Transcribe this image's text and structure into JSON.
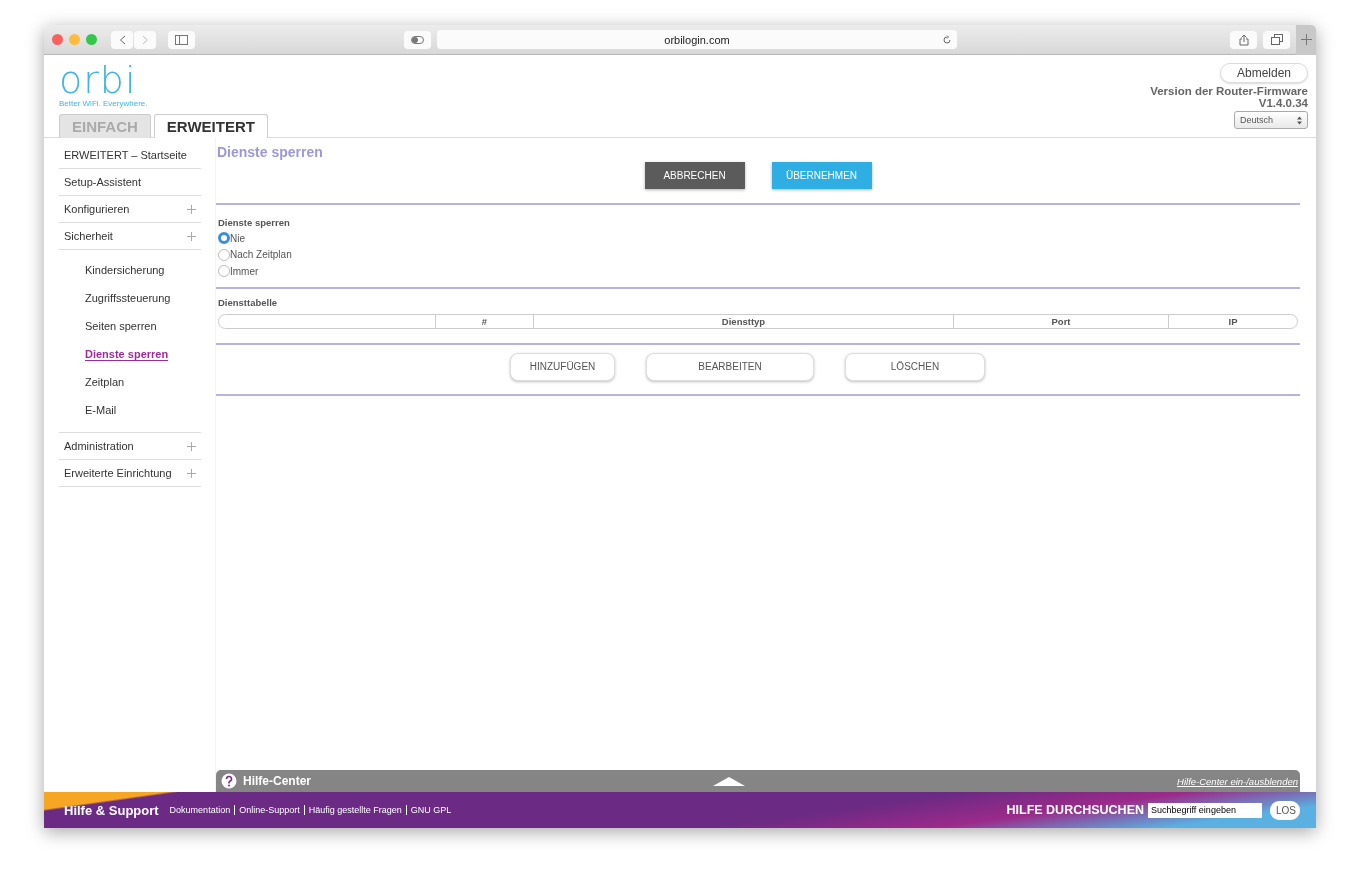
{
  "browser": {
    "url": "orbilogin.com"
  },
  "header": {
    "logo": "orbi",
    "tagline": "Better WiFi. Everywhere.",
    "logout": "Abmelden",
    "firmware_label": "Version der Router-Firmware",
    "firmware_version": "V1.4.0.34",
    "language": "Deutsch"
  },
  "mode_tabs": [
    {
      "label": "EINFACH",
      "selected": false
    },
    {
      "label": "ERWEITERT",
      "selected": true
    }
  ],
  "sidebar": {
    "items": [
      {
        "label": "ERWEITERT – Startseite",
        "expandable": false,
        "selected": false
      },
      {
        "label": "Setup-Assistent",
        "expandable": false,
        "selected": false
      },
      {
        "label": "Konfigurieren",
        "expandable": true,
        "selected": false
      },
      {
        "label": "Sicherheit",
        "expandable": true,
        "selected": false,
        "children": [
          {
            "label": "Kindersicherung",
            "selected": false
          },
          {
            "label": "Zugriffssteuerung",
            "selected": false
          },
          {
            "label": "Seiten sperren",
            "selected": false
          },
          {
            "label": "Dienste sperren",
            "selected": true
          },
          {
            "label": "Zeitplan",
            "selected": false
          },
          {
            "label": "E-Mail",
            "selected": false
          }
        ]
      },
      {
        "label": "Administration",
        "expandable": true,
        "selected": false
      },
      {
        "label": "Erweiterte Einrichtung",
        "expandable": true,
        "selected": false
      }
    ]
  },
  "main": {
    "title": "Dienste sperren",
    "cancel": "ABBRECHEN",
    "apply": "ÜBERNEHMEN",
    "block_services": {
      "label": "Dienste sperren",
      "options": [
        {
          "label": "Nie",
          "selected": true
        },
        {
          "label": "Nach Zeitplan",
          "selected": false
        },
        {
          "label": "Immer",
          "selected": false
        }
      ]
    },
    "table": {
      "title": "Diensttabelle",
      "columns": [
        "#",
        "Diensttyp",
        "Port",
        "IP"
      ]
    },
    "actions": [
      "HINZUFÜGEN",
      "BEARBEITEN",
      "LÖSCHEN"
    ]
  },
  "help_bar": {
    "title": "Hilfe-Center",
    "toggle_link": "Hilfe-Center ein-/ausblenden"
  },
  "footer": {
    "title": "Hilfe & Support",
    "links": [
      "Dokumentation",
      "Online-Support",
      "Häufig gestellte Fragen",
      "GNU GPL"
    ],
    "search_label": "HILFE DURCHSUCHEN",
    "search_value": "Suchbegriff eingeben",
    "search_button": "LOS"
  }
}
